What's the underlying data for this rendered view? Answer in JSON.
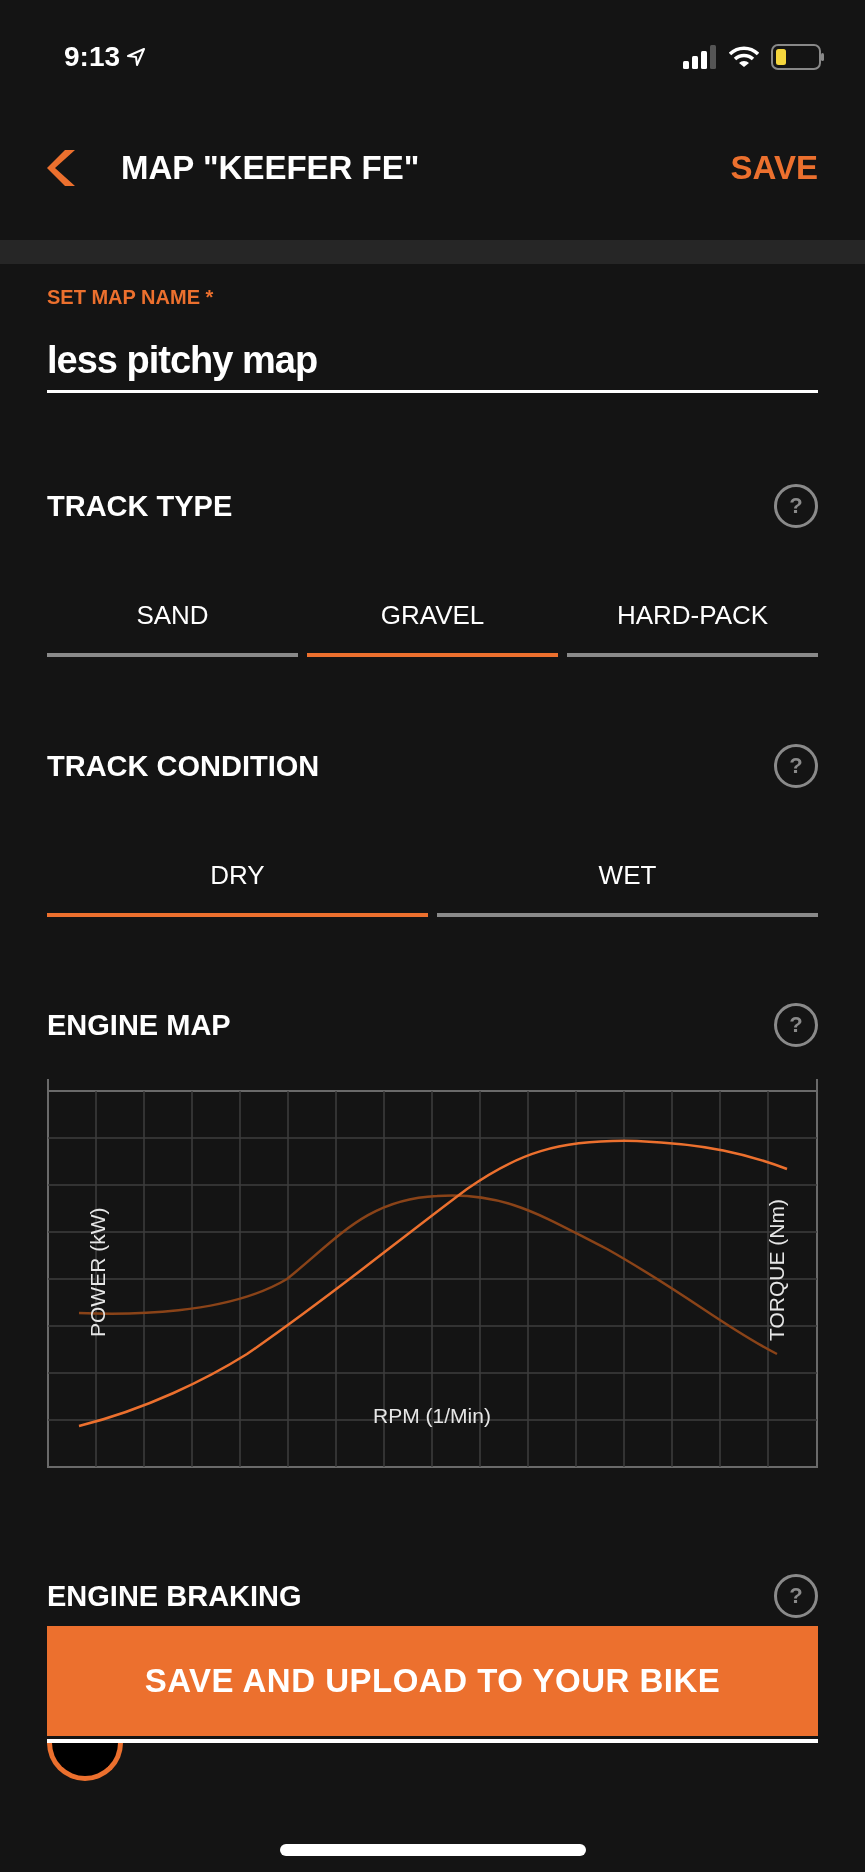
{
  "status_bar": {
    "time": "9:13"
  },
  "header": {
    "title": "MAP \"KEEFER FE\"",
    "save": "SAVE"
  },
  "map_name": {
    "label": "SET MAP NAME *",
    "value": "less pitchy map"
  },
  "track_type": {
    "title": "TRACK TYPE",
    "help": "?",
    "options": [
      {
        "label": "SAND",
        "selected": false
      },
      {
        "label": "GRAVEL",
        "selected": true
      },
      {
        "label": "HARD-PACK",
        "selected": false
      }
    ]
  },
  "track_condition": {
    "title": "TRACK CONDITION",
    "help": "?",
    "options": [
      {
        "label": "DRY",
        "selected": true
      },
      {
        "label": "WET",
        "selected": false
      }
    ]
  },
  "engine_map": {
    "title": "ENGINE MAP",
    "help": "?",
    "chart": {
      "kind": "picture",
      "ylabel_left": "POWER (kW)",
      "ylabel_right": "TORQUE (Nm)",
      "xlabel": "RPM (1/Min)"
    }
  },
  "engine_braking": {
    "title": "ENGINE BRAKING",
    "help": "?",
    "slider": {
      "level": 0
    }
  },
  "upload_button": "SAVE AND UPLOAD TO YOUR BIKE"
}
